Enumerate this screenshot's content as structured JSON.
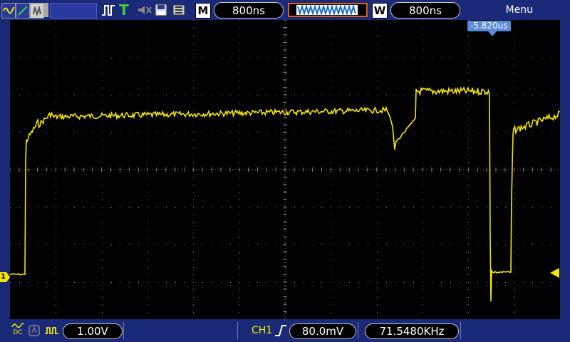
{
  "toolbar": {
    "menu_label": "Menu",
    "time_base": "800ns",
    "window_time": "800ns",
    "m_label": "M",
    "w_label": "W",
    "trigger_mode_label": "T"
  },
  "screen": {
    "trigger_offset": "-5.820us",
    "channel_marker": "1"
  },
  "footer": {
    "coupling": "DC",
    "volts_per_div": "1.00V",
    "trigger_source": "CH1",
    "trigger_level": "80.0mV",
    "frequency": "71.5480KHz"
  },
  "colors": {
    "ch1": "#f5e600",
    "background": "#1a2a78",
    "screen": "#000000",
    "grid": "#7a7a7a",
    "offset_tag": "#5a8ad8"
  }
}
